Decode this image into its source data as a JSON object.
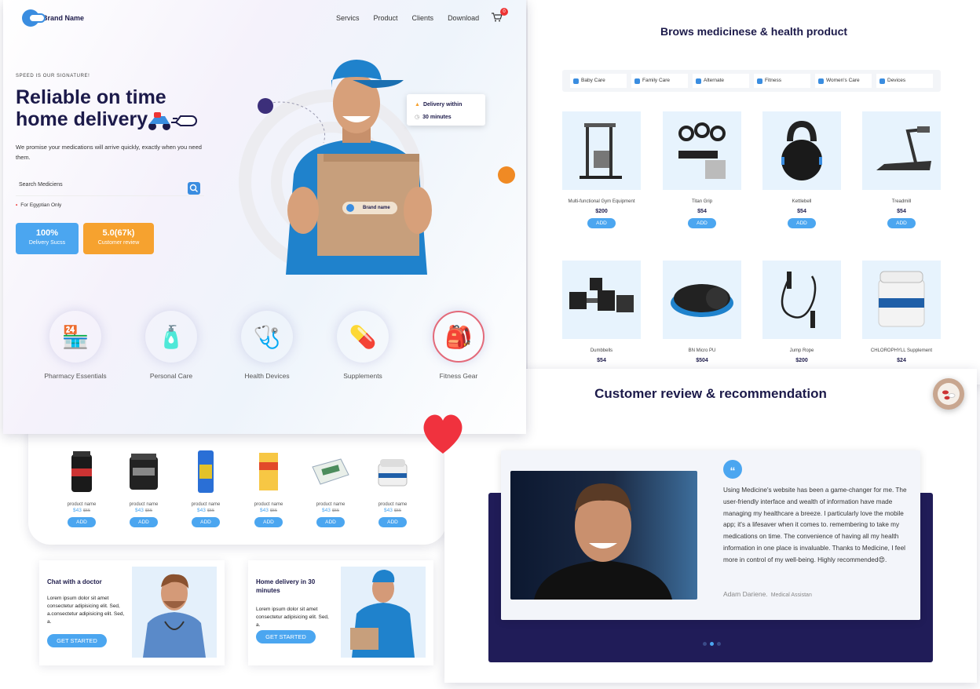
{
  "hero": {
    "brand": "Brand Name",
    "nav": [
      "Servics",
      "Product",
      "Clients",
      "Download"
    ],
    "cart_count": "0",
    "eyebrow": "SPEED IS OUR SIGNATURE!",
    "headline_1": "Reliable on time",
    "headline_2": "home delivery",
    "description": "We promise your medications will arrive quickly, exactly when you need them.",
    "search_placeholder": "Search Mediciens",
    "note": "For Egyptian Only",
    "stats": [
      {
        "value": "100%",
        "label": "Delivery Sucss",
        "color": "#4ba6f0"
      },
      {
        "value": "5.0(67k)",
        "label": "Customer review",
        "color": "#f6a22f"
      }
    ],
    "delivery_card": {
      "line1": "Delivery within",
      "line2": "30 minutes"
    },
    "box_label": "Brand name",
    "categories": [
      {
        "label": "Pharmacy Essentials",
        "icon": "pharmacy-icon",
        "bg": "#e6e8ff"
      },
      {
        "label": "Personal Care",
        "icon": "personal-care-icon",
        "bg": "#fff0e2"
      },
      {
        "label": "Health Devices",
        "icon": "health-devices-icon",
        "bg": "#dff3f8"
      },
      {
        "label": "Supplements",
        "icon": "supplements-icon",
        "bg": "#e4f6e4"
      },
      {
        "label": "Fitness Gear",
        "icon": "fitness-gear-icon",
        "bg": "#ffffff"
      }
    ]
  },
  "browse": {
    "title": "Brows medicinese & health product",
    "filters": [
      "Baby Care",
      "Family Care",
      "Alternate",
      "Fitness",
      "Women's Care",
      "Devices"
    ],
    "add_label": "ADD",
    "products": [
      {
        "name": "Multi-functional Gym Equipment",
        "price": "$200"
      },
      {
        "name": "Titan Grip",
        "price": "$54"
      },
      {
        "name": "Kettlebell",
        "price": "$54"
      },
      {
        "name": "Treadmill",
        "price": "$54"
      },
      {
        "name": "Dumbbells",
        "price": "$54"
      },
      {
        "name": "BN Micro PU",
        "price": "$504"
      },
      {
        "name": "Jump Rope",
        "price": "$200"
      },
      {
        "name": "CHLOROPHYLL Supplement",
        "price": "$24"
      }
    ]
  },
  "strip": {
    "add_label": "ADD",
    "products": [
      {
        "name": "product name",
        "price": "$43",
        "old": "$55"
      },
      {
        "name": "product name",
        "price": "$43",
        "old": "$55"
      },
      {
        "name": "product name",
        "price": "$43",
        "old": "$55"
      },
      {
        "name": "product name",
        "price": "$43",
        "old": "$55"
      },
      {
        "name": "product name",
        "price": "$43",
        "old": "$55"
      },
      {
        "name": "product name",
        "price": "$43",
        "old": "$55"
      }
    ]
  },
  "promos": [
    {
      "title": "Chat with a doctor",
      "text": "Lorem ipsum dolor sit amet consectetur adipisicing elit. Sed, a.consectetur adipisicing elit. Sed, a.",
      "button": "GET STARTED"
    },
    {
      "title": "Home delivery in 30 minutes",
      "text": "Lorem ipsum dolor sit amet consectetur adipisicing elit. Sed, a.",
      "button": "GET STARTED"
    }
  ],
  "review": {
    "title": "Customer review & recommendation",
    "text": "Using Medicine's website has been a game-changer for me. The user-friendly interface and wealth of information have made managing my healthcare a breeze. I particularly love the mobile app; it's a lifesaver when it comes to. remembering to take my medications on time. The convenience of having all my health information in one place is invaluable. Thanks to Medicine, I feel more in control of my well-being. Highly recommended😍.",
    "author": "Adam Dariene.",
    "role": "Medical Assistan"
  }
}
